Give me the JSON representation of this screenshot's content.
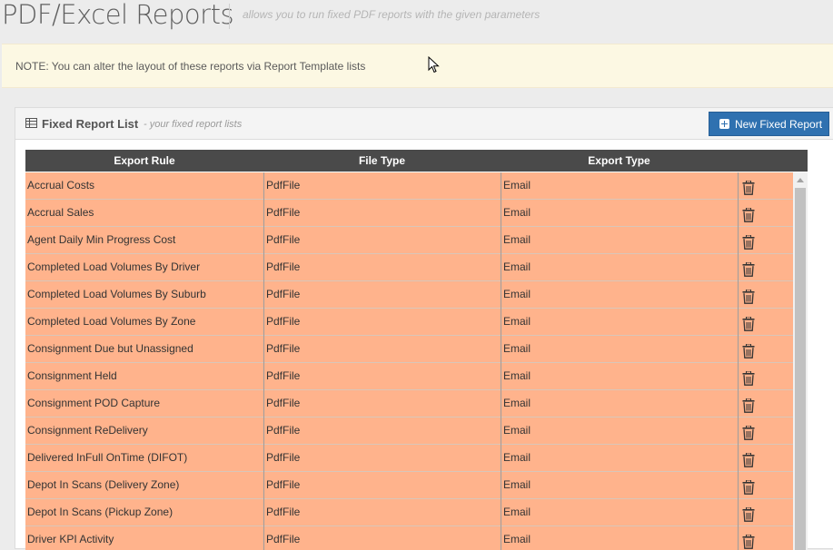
{
  "header": {
    "title": "PDF/Excel Reports",
    "subtitle": "allows you to run fixed PDF reports with the given parameters"
  },
  "note": {
    "text": "NOTE: You can alter the layout of these reports via Report Template lists"
  },
  "panel": {
    "icon": "table-icon",
    "title": "Fixed Report List",
    "subtitle": "- your fixed report lists",
    "new_button_label": "New Fixed Report",
    "new_button_icon": "plus-square-icon"
  },
  "table": {
    "columns": [
      "Export Rule",
      "File Type",
      "Export Type",
      ""
    ],
    "action_icon": "trash-icon",
    "rows": [
      {
        "rule": "Accrual Costs",
        "file_type": "PdfFile",
        "export_type": "Email"
      },
      {
        "rule": "Accrual Sales",
        "file_type": "PdfFile",
        "export_type": "Email"
      },
      {
        "rule": "Agent Daily Min Progress Cost",
        "file_type": "PdfFile",
        "export_type": "Email"
      },
      {
        "rule": "Completed Load Volumes By Driver",
        "file_type": "PdfFile",
        "export_type": "Email"
      },
      {
        "rule": "Completed Load Volumes By Suburb",
        "file_type": "PdfFile",
        "export_type": "Email"
      },
      {
        "rule": "Completed Load Volumes By Zone",
        "file_type": "PdfFile",
        "export_type": "Email"
      },
      {
        "rule": "Consignment Due but Unassigned",
        "file_type": "PdfFile",
        "export_type": "Email"
      },
      {
        "rule": "Consignment Held",
        "file_type": "PdfFile",
        "export_type": "Email"
      },
      {
        "rule": "Consignment POD Capture",
        "file_type": "PdfFile",
        "export_type": "Email"
      },
      {
        "rule": "Consignment ReDelivery",
        "file_type": "PdfFile",
        "export_type": "Email"
      },
      {
        "rule": "Delivered InFull OnTime (DIFOT)",
        "file_type": "PdfFile",
        "export_type": "Email"
      },
      {
        "rule": "Depot In Scans (Delivery Zone)",
        "file_type": "PdfFile",
        "export_type": "Email"
      },
      {
        "rule": "Depot In Scans (Pickup Zone)",
        "file_type": "PdfFile",
        "export_type": "Email"
      },
      {
        "rule": "Driver KPI Activity",
        "file_type": "PdfFile",
        "export_type": "Email"
      }
    ]
  },
  "colors": {
    "row_background": "#ffb38c",
    "header_background": "#4a4a4a",
    "primary_button": "#2f71b0",
    "note_background": "#fcf8e3"
  }
}
